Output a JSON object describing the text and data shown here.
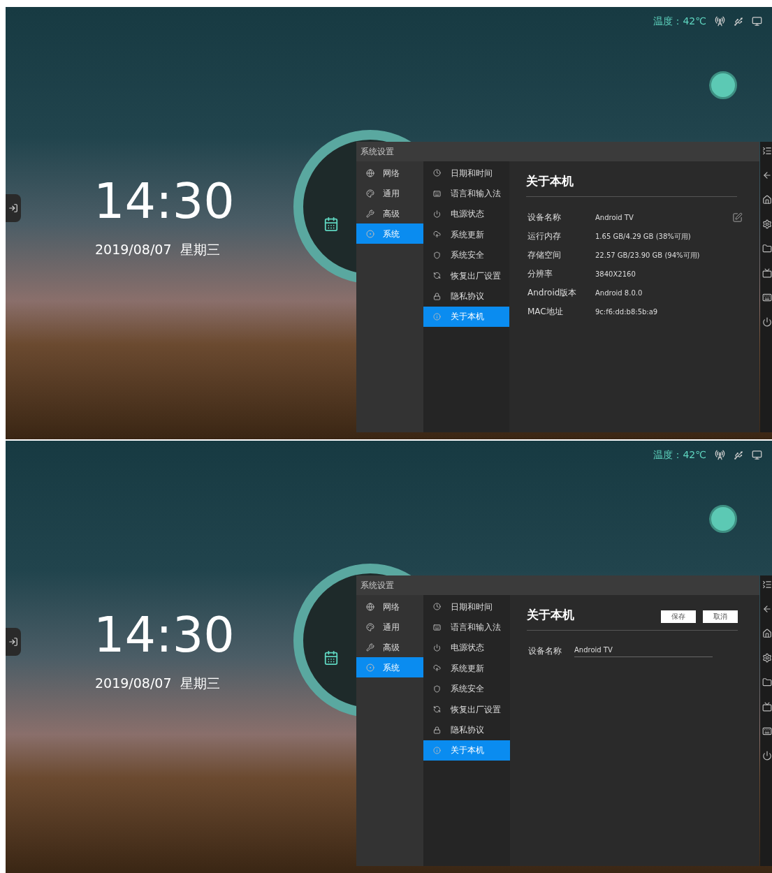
{
  "screens": [
    {
      "status_bar": {
        "temperature": "温度：42℃"
      },
      "clock": {
        "time": "14:30",
        "date": "2019/08/07",
        "weekday": "星期三"
      },
      "settings": {
        "title": "系统设置",
        "categories": [
          {
            "label": "网络",
            "selected": false
          },
          {
            "label": "通用",
            "selected": false
          },
          {
            "label": "高级",
            "selected": false
          },
          {
            "label": "系统",
            "selected": true
          }
        ],
        "items": [
          {
            "label": "日期和时间",
            "selected": false
          },
          {
            "label": "语言和输入法",
            "selected": false
          },
          {
            "label": "电源状态",
            "selected": false
          },
          {
            "label": "系统更新",
            "selected": false
          },
          {
            "label": "系统安全",
            "selected": false
          },
          {
            "label": "恢复出厂设置",
            "selected": false
          },
          {
            "label": "隐私协议",
            "selected": false
          },
          {
            "label": "关于本机",
            "selected": true
          }
        ],
        "detail": {
          "kind": "info",
          "heading": "关于本机",
          "rows": [
            {
              "label": "设备名称",
              "value": "Android TV"
            },
            {
              "label": "运行内存",
              "value": "1.65 GB/4.29 GB (38%可用)"
            },
            {
              "label": "存储空间",
              "value": "22.57 GB/23.90 GB (94%可用)"
            },
            {
              "label": "分辨率",
              "value": "3840X2160"
            },
            {
              "label": "Android版本",
              "value": "Android 8.0.0"
            },
            {
              "label": "MAC地址",
              "value": "9c:f6:dd:b8:5b:a9"
            }
          ]
        }
      }
    },
    {
      "status_bar": {
        "temperature": "温度：42℃"
      },
      "clock": {
        "time": "14:30",
        "date": "2019/08/07",
        "weekday": "星期三"
      },
      "settings": {
        "title": "系统设置",
        "categories": [
          {
            "label": "网络",
            "selected": false
          },
          {
            "label": "通用",
            "selected": false
          },
          {
            "label": "高级",
            "selected": false
          },
          {
            "label": "系统",
            "selected": true
          }
        ],
        "items": [
          {
            "label": "日期和时间",
            "selected": false
          },
          {
            "label": "语言和输入法",
            "selected": false
          },
          {
            "label": "电源状态",
            "selected": false
          },
          {
            "label": "系统更新",
            "selected": false
          },
          {
            "label": "系统安全",
            "selected": false
          },
          {
            "label": "恢复出厂设置",
            "selected": false
          },
          {
            "label": "隐私协议",
            "selected": false
          },
          {
            "label": "关于本机",
            "selected": true
          }
        ],
        "detail": {
          "kind": "edit",
          "heading": "关于本机",
          "buttons": [
            "保存",
            "取消"
          ],
          "rows": [
            {
              "label": "设备名称",
              "value": "Android TV"
            }
          ]
        }
      }
    }
  ]
}
